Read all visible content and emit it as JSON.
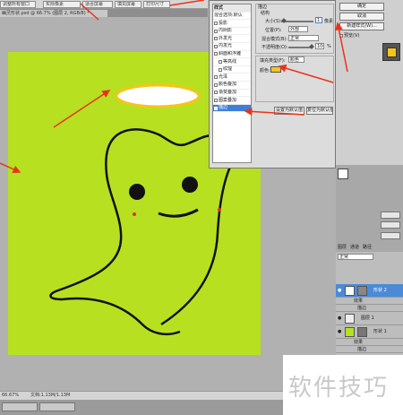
{
  "toolbar": {
    "btn1": "调整所有窗口",
    "btn2": "实际像素",
    "btn3": "适合屏幕",
    "btn4": "填充屏幕",
    "btn5": "打印尺寸"
  },
  "document": {
    "tab": "幽灵形状.psd @ 66.7% (图层 2, RGB/8) *"
  },
  "dialog": {
    "title": "样式",
    "styles": [
      {
        "label": "混合选项:默认",
        "checked": false
      },
      {
        "label": "投影",
        "checked": false
      },
      {
        "label": "内阴影",
        "checked": false
      },
      {
        "label": "外发光",
        "checked": false
      },
      {
        "label": "内发光",
        "checked": false
      },
      {
        "label": "斜面和浮雕",
        "checked": false
      },
      {
        "label": "等高线",
        "checked": false
      },
      {
        "label": "纹理",
        "checked": false
      },
      {
        "label": "光泽",
        "checked": false
      },
      {
        "label": "颜色叠加",
        "checked": false
      },
      {
        "label": "渐变叠加",
        "checked": false
      },
      {
        "label": "图案叠加",
        "checked": false
      },
      {
        "label": "描边",
        "checked": true
      }
    ],
    "stroke_title": "描边",
    "structure_title": "结构",
    "size_label": "大小(S):",
    "size_value": "1",
    "size_unit": "像素",
    "position_label": "位置(P):",
    "position_value": "外部",
    "blend_label": "混合模式(B):",
    "blend_value": "正常",
    "opacity_label": "不透明度(O):",
    "opacity_value": "100",
    "opacity_unit": "%",
    "fill_type_label": "填充类型(F):",
    "fill_type_value": "颜色",
    "color_label": "颜色:",
    "stroke_color": "#f5c518",
    "default_btn": "设置为默认值",
    "reset_btn": "复位为默认值"
  },
  "right": {
    "ok": "确定",
    "cancel": "取消",
    "new_style": "新建样式(W)...",
    "preview": "预览(V)"
  },
  "layers": {
    "blend": "正常",
    "tabs": [
      "图层",
      "通道",
      "路径"
    ],
    "rows": [
      {
        "name": "形状 2",
        "selected": true
      },
      {
        "name": "效果",
        "selected": false
      },
      {
        "name": "描边",
        "selected": false
      },
      {
        "name": "图层 1",
        "selected": false
      },
      {
        "name": "形状 1",
        "selected": false
      },
      {
        "name": "效果",
        "selected": false
      },
      {
        "name": "描边",
        "selected": false
      }
    ]
  },
  "status": {
    "zoom": "66.67%",
    "doc": "文档:1.13M/1.13M"
  },
  "taskbar": {
    "item1": "",
    "item2": ""
  },
  "watermark": "软件技巧",
  "colors": {
    "artboard": "#b7e021",
    "arrows": "#e8341c",
    "selection": "#3f7ed7"
  }
}
